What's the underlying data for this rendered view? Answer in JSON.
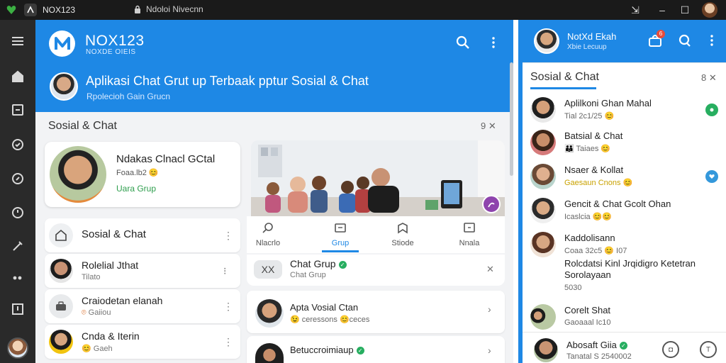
{
  "window": {
    "title": "NOX123",
    "path_text": "Ndoloi Nivecnn"
  },
  "header": {
    "brand_title": "NOX123",
    "brand_sub": "NOXDE OIEIS",
    "headline": "Aplikasi Chat Grut up Terbaak pptur Sosial & Chat",
    "subline": "Rpolecioh Gain Grucn"
  },
  "main": {
    "section_title": "Sosial & Chat",
    "section_ctrl": "9 ✕",
    "featured": {
      "name": "Ndakas Clnacl GCtal",
      "meta": "Foaa.lb2",
      "group": "Uara Grup"
    },
    "tabs": [
      {
        "label": "Nlacrlo",
        "icon": "search-icon"
      },
      {
        "label": "Grup",
        "icon": "group-icon"
      },
      {
        "label": "Stiode",
        "icon": "story-icon"
      },
      {
        "label": "Nnala",
        "icon": "chat-icon"
      }
    ],
    "chat_group": {
      "name": "Chat Grup",
      "sub": "Chat Grup",
      "icon_text": "XX"
    },
    "left_list": [
      {
        "title": "Sosial & Chat",
        "sub": "",
        "kind": "home"
      },
      {
        "title": "Rolelial Jthat",
        "sub": "Tilato",
        "kind": "person"
      },
      {
        "title": "Craiodetan elanah",
        "sub": "Gaiiou",
        "kind": "system"
      },
      {
        "title": "Cnda & Iterin",
        "sub": "Gaeh",
        "kind": "person2"
      }
    ],
    "chat_cards": [
      {
        "title": "Apta Vosial Ctan",
        "sub": "😉 ceressons 😊ceces"
      },
      {
        "title": "Betuccroimiaup",
        "sub": "🙂 🤗"
      }
    ]
  },
  "right": {
    "header_title": "NotXd Ekah",
    "header_sub": "Xbie Lecuup",
    "badge": "6",
    "section_title": "Sosial & Chat",
    "section_ctrl": "8 ✕",
    "rows": [
      {
        "title": "Aplilkoni Ghan Mahal",
        "sub": "Tial 2c1/25 😊",
        "badge": "green"
      },
      {
        "title": "Batsial & Chat",
        "sub": "👪 Taiaes 😊",
        "badge": ""
      },
      {
        "title": "Nsaer & Kollat",
        "sub": "Gaesaun Cnons 😊",
        "badge": "blue"
      },
      {
        "title": "Gencit & Chat Gcolt Ohan",
        "sub": "Icaslcia 😊😊",
        "badge": ""
      },
      {
        "title": "Kaddolisann",
        "sub": "Coaa 32c5 😊 I07",
        "badge": ""
      },
      {
        "title": "Rolcdatsi Kinl Jrqidigro Ketetran Sorolayaan",
        "sub": "5030",
        "badge": ""
      },
      {
        "title": "Corelt Shat",
        "sub": "Gaoaaal Ic10",
        "badge": ""
      }
    ],
    "bottom": {
      "title": "Abosaft Giia",
      "sub": "Tanatal  S 2540002"
    }
  },
  "colors": {
    "accent": "#1e88e5",
    "rail": "#2a2a2a",
    "titlebar": "#1a1a1a",
    "online_green": "#27ae60"
  }
}
